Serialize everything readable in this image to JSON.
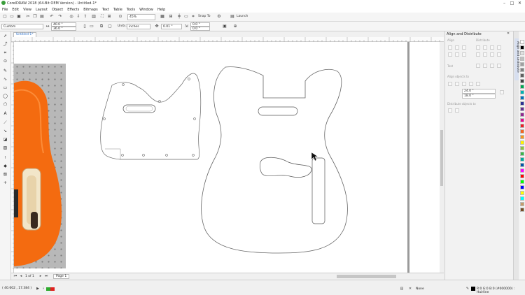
{
  "title_bar": {
    "title": "CorelDRAW 2018 (64-Bit OEM Version) - Untitled-1*",
    "min": "–",
    "max": "□",
    "close": "✕"
  },
  "menu": [
    "File",
    "Edit",
    "View",
    "Layout",
    "Object",
    "Effects",
    "Bitmaps",
    "Text",
    "Table",
    "Tools",
    "Window",
    "Help"
  ],
  "std_toolbar": {
    "zoom": "45%",
    "snap_to": "Snap To",
    "launch": "Launch"
  },
  "prop_bar": {
    "page_preset": "Custom",
    "width": "40.0 \"",
    "height": "36.0 \"",
    "units_label": "Units:",
    "units_value": "inches",
    "nudge": "0.01 \"",
    "dup_x": "0.0 \"",
    "dup_y": "0.0 \""
  },
  "doc_tab": "Untitled-1*",
  "page_nav": {
    "position": "1 of 1",
    "page_tab": "Page 1"
  },
  "ruler_units": "inches",
  "docker": {
    "title": "Align and Distribute",
    "align_label": "Align",
    "distribute_label": "Distribute",
    "text_label": "Text",
    "align_objects_to_label": "Align objects to",
    "distribute_to_label": "Distribute objects to",
    "field_a": "24.0 \"",
    "field_b": "18.0 \"",
    "side_tab": "Align and Distribute"
  },
  "status": {
    "coords": "( 40.602 , 17.384 )",
    "fill_label": "None",
    "outline_label": "R:0 G:0 B:0 (#000000) : Hairline"
  },
  "colors": {
    "palette": [
      "#ffffff",
      "#000000",
      "#e0e0e0",
      "#c0c0c0",
      "#a0a0a0",
      "#808080",
      "#606060",
      "#404040",
      "#00a651",
      "#00b2b2",
      "#0072bc",
      "#2e3192",
      "#662d91",
      "#92278f",
      "#ec008c",
      "#ed1c24",
      "#f26522",
      "#f7941d",
      "#fff200",
      "#8dc63f",
      "#39b54a",
      "#00a99d",
      "#0054a6",
      "#ff00ff",
      "#ff0000",
      "#00ff00",
      "#0000ff",
      "#ffff00",
      "#00ffff",
      "#c69c6d",
      "#754c24"
    ],
    "accent_blue": "#2a6ec7",
    "guitar_orange": "#f46b10",
    "status_fill": "#2eaa2e",
    "status_outline": "#e02020"
  }
}
